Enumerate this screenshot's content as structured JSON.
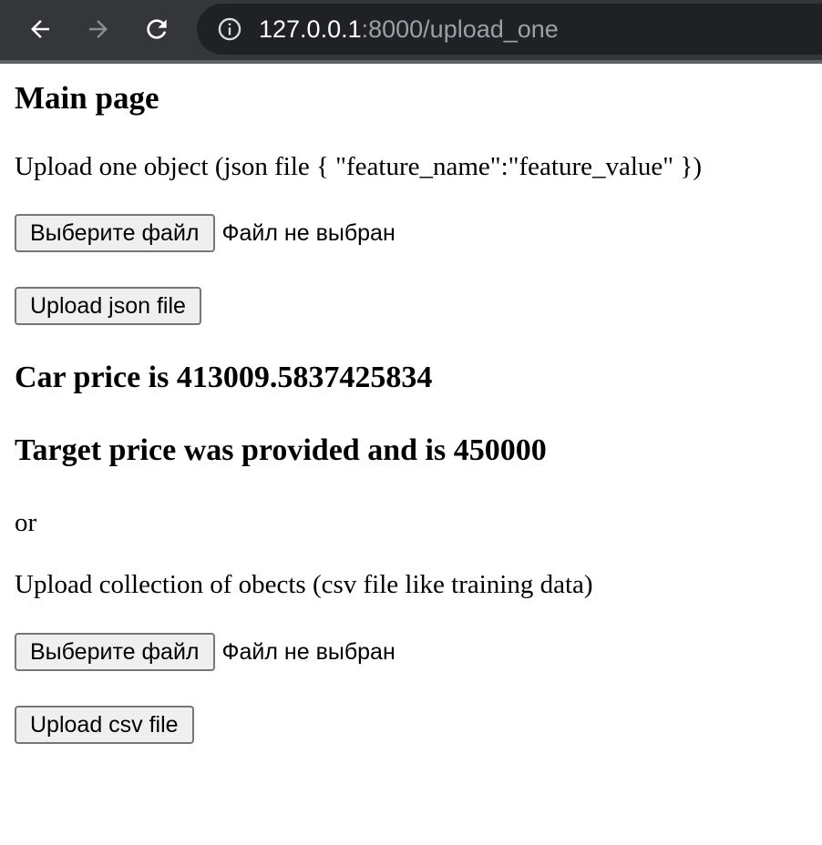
{
  "browser": {
    "url_host": "127.0.0.1",
    "url_path": ":8000/upload_one"
  },
  "page": {
    "title": "Main page",
    "single_upload": {
      "instruction": "Upload one object (json file { \"feature_name\":\"feature_value\" })",
      "choose_file_label": "Выберите файл",
      "file_status": "Файл не выбран",
      "submit_label": "Upload json file"
    },
    "result": {
      "car_price": "Car price is 413009.5837425834",
      "target_price": "Target price was provided and is 450000"
    },
    "separator": "or",
    "batch_upload": {
      "instruction": "Upload collection of obects (csv file like training data)",
      "choose_file_label": "Выберите файл",
      "file_status": "Файл не выбран",
      "submit_label": "Upload csv file"
    }
  },
  "colors": {
    "toolbar": "#35363a",
    "omnibox": "#202124",
    "url_host": "#ffffff",
    "url_path": "#9aa0a6"
  }
}
